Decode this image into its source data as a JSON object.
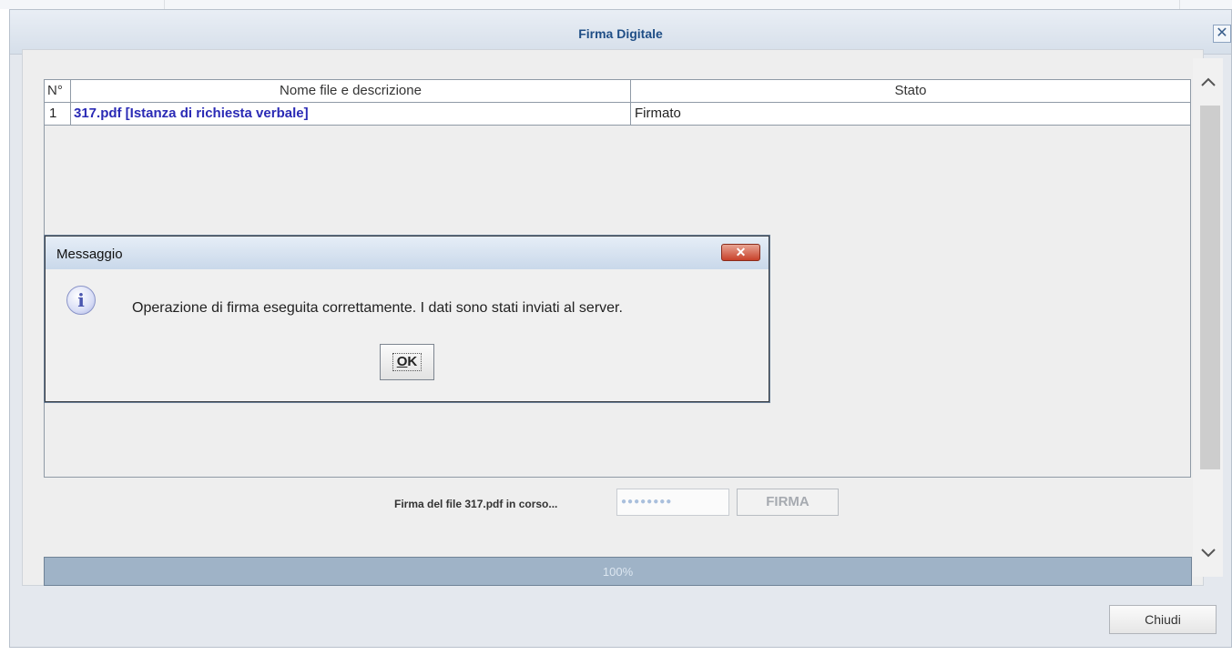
{
  "window": {
    "title": "Firma Digitale",
    "close_glyph": "✕"
  },
  "table": {
    "headers": [
      "N°",
      "Nome file e descrizione",
      "Stato"
    ],
    "rows": [
      {
        "num": "1",
        "name": "317.pdf [Istanza di richiesta verbale]",
        "state": "Firmato"
      }
    ]
  },
  "signing": {
    "status_text": "Firma del file 317.pdf in corso...",
    "pin_mask": "●●●●●●●●",
    "firma_label": "FIRMA"
  },
  "progress": {
    "value": 1.0,
    "label": "100%"
  },
  "footer": {
    "close_label": "Chiudi"
  },
  "dialog": {
    "title": "Messaggio",
    "message": "Operazione di firma eseguita correttamente. I dati sono stati inviati al server.",
    "ok_mnemonic": "O",
    "ok_rest": "K",
    "close_glyph": "✕"
  },
  "icons": {
    "info": "info-icon",
    "close": "close-icon",
    "scroll_up": "chevron-up-icon",
    "scroll_down": "chevron-down-icon"
  },
  "colors": {
    "title_text": "#1f4e86",
    "link_text": "#2a2ab5",
    "progress_fill": "#9fb3c7",
    "dialog_close": "#c8412a"
  }
}
